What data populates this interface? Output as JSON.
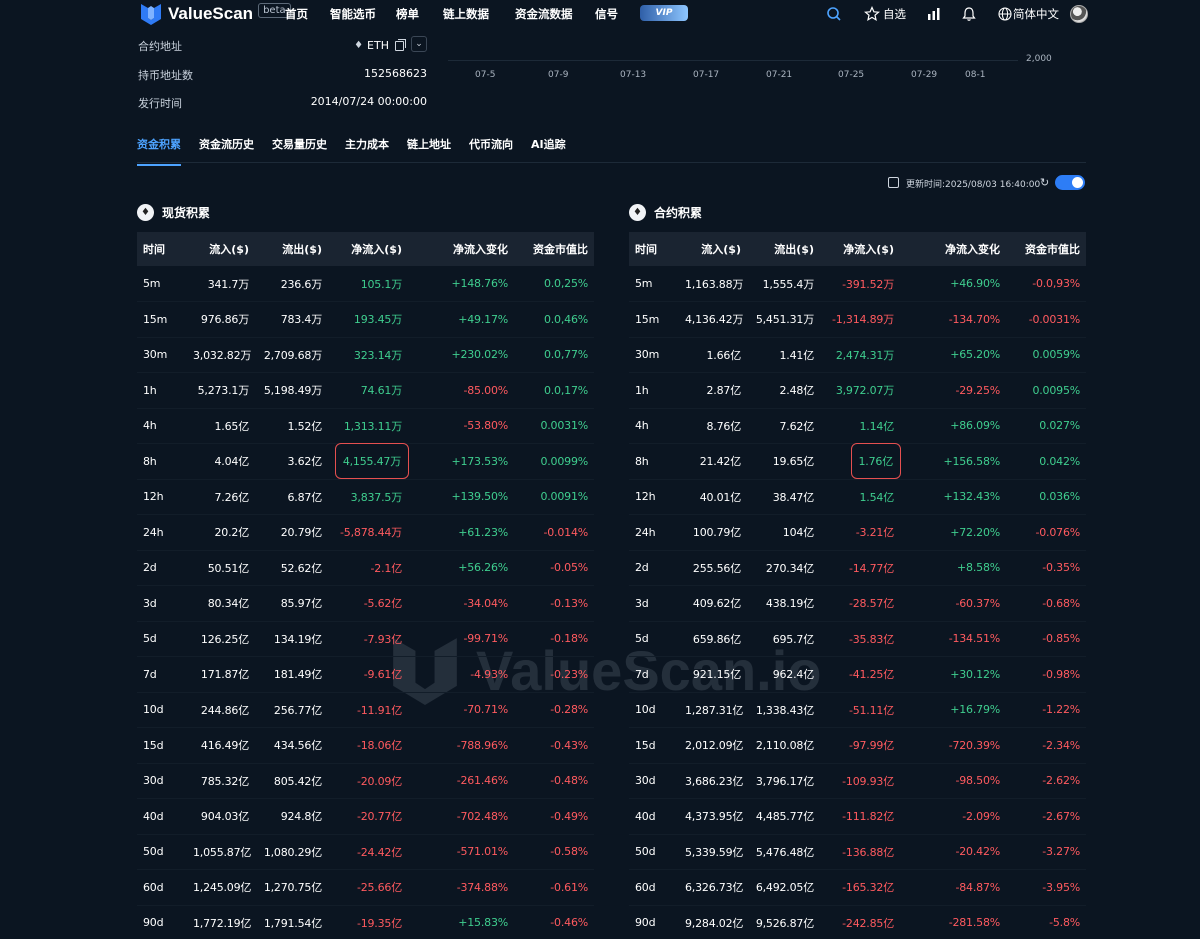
{
  "nav": {
    "brand": "ValueScan",
    "beta": "beta",
    "items": [
      "首页",
      "智能选币",
      "榜单",
      "链上数据",
      "资金流数据",
      "信号"
    ],
    "vip": "VIP",
    "watchlist": "自选",
    "language": "简体中文"
  },
  "info": {
    "contract_label": "合约地址",
    "contract_value": "ETH",
    "holders_label": "持币地址数",
    "holders_value": "152568623",
    "issue_label": "发行时间",
    "issue_value": "2014/07/24 00:00:00"
  },
  "chart_axis": {
    "x_ticks": [
      "07-5",
      "07-9",
      "07-13",
      "07-17",
      "07-21",
      "07-25",
      "07-29",
      "08-1"
    ],
    "y_tick": "2,000"
  },
  "tabs": [
    "资金积累",
    "资金流历史",
    "交易量历史",
    "主力成本",
    "链上地址",
    "代币流向",
    "AI追踪"
  ],
  "update_time": "更新时间:2025/08/03 16:40:00",
  "columns": [
    "时间",
    "流入($)",
    "流出($)",
    "净流入($)",
    "净流入变化",
    "资金市值比"
  ],
  "spot": {
    "title": "现货积累",
    "rows": [
      [
        "5m",
        "341.7万",
        "236.6万",
        "105.1万",
        "+148.76%",
        "0.0,25%"
      ],
      [
        "15m",
        "976.86万",
        "783.4万",
        "193.45万",
        "+49.17%",
        "0.0,46%"
      ],
      [
        "30m",
        "3,032.82万",
        "2,709.68万",
        "323.14万",
        "+230.02%",
        "0.0,77%"
      ],
      [
        "1h",
        "5,273.1万",
        "5,198.49万",
        "74.61万",
        "-85.00%",
        "0.0,17%"
      ],
      [
        "4h",
        "1.65亿",
        "1.52亿",
        "1,313.11万",
        "-53.80%",
        "0.0031%"
      ],
      [
        "8h",
        "4.04亿",
        "3.62亿",
        "4,155.47万",
        "+173.53%",
        "0.0099%"
      ],
      [
        "12h",
        "7.26亿",
        "6.87亿",
        "3,837.5万",
        "+139.50%",
        "0.0091%"
      ],
      [
        "24h",
        "20.2亿",
        "20.79亿",
        "-5,878.44万",
        "+61.23%",
        "-0.014%"
      ],
      [
        "2d",
        "50.51亿",
        "52.62亿",
        "-2.1亿",
        "+56.26%",
        "-0.05%"
      ],
      [
        "3d",
        "80.34亿",
        "85.97亿",
        "-5.62亿",
        "-34.04%",
        "-0.13%"
      ],
      [
        "5d",
        "126.25亿",
        "134.19亿",
        "-7.93亿",
        "-99.71%",
        "-0.18%"
      ],
      [
        "7d",
        "171.87亿",
        "181.49亿",
        "-9.61亿",
        "-4.93%",
        "-0.23%"
      ],
      [
        "10d",
        "244.86亿",
        "256.77亿",
        "-11.91亿",
        "-70.71%",
        "-0.28%"
      ],
      [
        "15d",
        "416.49亿",
        "434.56亿",
        "-18.06亿",
        "-788.96%",
        "-0.43%"
      ],
      [
        "30d",
        "785.32亿",
        "805.42亿",
        "-20.09亿",
        "-261.46%",
        "-0.48%"
      ],
      [
        "40d",
        "904.03亿",
        "924.8亿",
        "-20.77亿",
        "-702.48%",
        "-0.49%"
      ],
      [
        "50d",
        "1,055.87亿",
        "1,080.29亿",
        "-24.42亿",
        "-571.01%",
        "-0.58%"
      ],
      [
        "60d",
        "1,245.09亿",
        "1,270.75亿",
        "-25.66亿",
        "-374.88%",
        "-0.61%"
      ],
      [
        "90d",
        "1,772.19亿",
        "1,791.54亿",
        "-19.35亿",
        "+15.83%",
        "-0.46%"
      ]
    ]
  },
  "futures": {
    "title": "合约积累",
    "rows": [
      [
        "5m",
        "1,163.88万",
        "1,555.4万",
        "-391.52万",
        "+46.90%",
        "-0.0,93%"
      ],
      [
        "15m",
        "4,136.42万",
        "5,451.31万",
        "-1,314.89万",
        "-134.70%",
        "-0.0031%"
      ],
      [
        "30m",
        "1.66亿",
        "1.41亿",
        "2,474.31万",
        "+65.20%",
        "0.0059%"
      ],
      [
        "1h",
        "2.87亿",
        "2.48亿",
        "3,972.07万",
        "-29.25%",
        "0.0095%"
      ],
      [
        "4h",
        "8.76亿",
        "7.62亿",
        "1.14亿",
        "+86.09%",
        "0.027%"
      ],
      [
        "8h",
        "21.42亿",
        "19.65亿",
        "1.76亿",
        "+156.58%",
        "0.042%"
      ],
      [
        "12h",
        "40.01亿",
        "38.47亿",
        "1.54亿",
        "+132.43%",
        "0.036%"
      ],
      [
        "24h",
        "100.79亿",
        "104亿",
        "-3.21亿",
        "+72.20%",
        "-0.076%"
      ],
      [
        "2d",
        "255.56亿",
        "270.34亿",
        "-14.77亿",
        "+8.58%",
        "-0.35%"
      ],
      [
        "3d",
        "409.62亿",
        "438.19亿",
        "-28.57亿",
        "-60.37%",
        "-0.68%"
      ],
      [
        "5d",
        "659.86亿",
        "695.7亿",
        "-35.83亿",
        "-134.51%",
        "-0.85%"
      ],
      [
        "7d",
        "921.15亿",
        "962.4亿",
        "-41.25亿",
        "+30.12%",
        "-0.98%"
      ],
      [
        "10d",
        "1,287.31亿",
        "1,338.43亿",
        "-51.11亿",
        "+16.79%",
        "-1.22%"
      ],
      [
        "15d",
        "2,012.09亿",
        "2,110.08亿",
        "-97.99亿",
        "-720.39%",
        "-2.34%"
      ],
      [
        "30d",
        "3,686.23亿",
        "3,796.17亿",
        "-109.93亿",
        "-98.50%",
        "-2.62%"
      ],
      [
        "40d",
        "4,373.95亿",
        "4,485.77亿",
        "-111.82亿",
        "-2.09%",
        "-2.67%"
      ],
      [
        "50d",
        "5,339.59亿",
        "5,476.48亿",
        "-136.88亿",
        "-20.42%",
        "-3.27%"
      ],
      [
        "60d",
        "6,326.73亿",
        "6,492.05亿",
        "-165.32亿",
        "-84.87%",
        "-3.95%"
      ],
      [
        "90d",
        "9,284.02亿",
        "9,526.87亿",
        "-242.85亿",
        "-281.58%",
        "-5.8%"
      ]
    ]
  },
  "highlight_row": "8h",
  "watermark": "ValueScan.io",
  "colors": {
    "positive": "#3fce8f",
    "negative": "#ff5a5f",
    "accent": "#4da3ff",
    "background": "#0b1521"
  }
}
